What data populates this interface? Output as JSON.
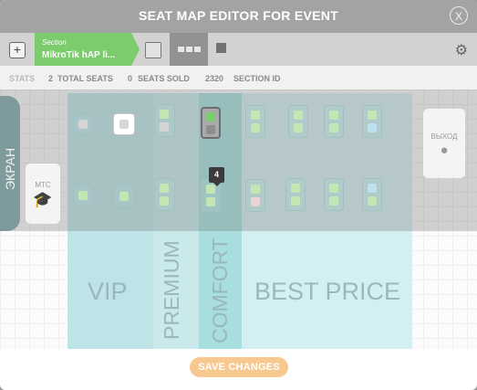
{
  "header": {
    "title": "SEAT MAP EDITOR FOR EVENT",
    "close_glyph": "X"
  },
  "toolbar": {
    "add_glyph": "+",
    "section_caption": "Section",
    "section_name": "MikroTik hAP li...",
    "gear_icon": "gear-icon"
  },
  "stats": {
    "stats_label": "STATS",
    "total_seats_value": "2",
    "total_seats_label": "TOTAL SEATS",
    "seats_sold_value": "0",
    "seats_sold_label": "SEATS SOLD",
    "section_id_value": "2320",
    "section_id_label": "SECTION ID"
  },
  "map": {
    "screen_label": "ЭКРАН",
    "mts_label": "МТС",
    "exit_label": "ВЫХОД",
    "zones": {
      "vip": "VIP",
      "premium": "PREMIUM",
      "comfort": "COMFORT",
      "best_price": "BEST PRICE"
    },
    "tooltip_value": "4"
  },
  "colors": {
    "zone_vip": "#bfe4e7",
    "zone_premium": "#c9e9eb",
    "zone_comfort": "#a8dede",
    "zone_best": "#d4eff1",
    "seat_green": "#c4e6b3",
    "seat_grey": "#d5d5d5",
    "seat_blue": "#bfe0ef",
    "seat_pink": "#ecd3d3",
    "accent_save": "#f7c88f"
  },
  "footer": {
    "save_label": "SAVE CHANGES"
  }
}
